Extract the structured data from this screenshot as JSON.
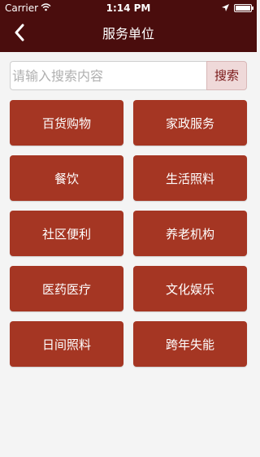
{
  "status_bar": {
    "carrier": "Carrier",
    "time": "1:14 PM"
  },
  "nav": {
    "title": "服务单位",
    "back_icon": "chevron-left-icon"
  },
  "search": {
    "placeholder": "请输入搜索内容",
    "value": "",
    "button_label": "搜索"
  },
  "categories": [
    {
      "label": "百货购物"
    },
    {
      "label": "家政服务"
    },
    {
      "label": "餐饮"
    },
    {
      "label": "生活照料"
    },
    {
      "label": "社区便利"
    },
    {
      "label": "养老机构"
    },
    {
      "label": "医药医疗"
    },
    {
      "label": "文化娱乐"
    },
    {
      "label": "日间照料"
    },
    {
      "label": "跨年失能"
    }
  ],
  "colors": {
    "header_bg": "#4a0d0d",
    "category_bg": "#a53623",
    "search_button_bg": "#efd9d9",
    "search_button_text": "#7a1818"
  }
}
